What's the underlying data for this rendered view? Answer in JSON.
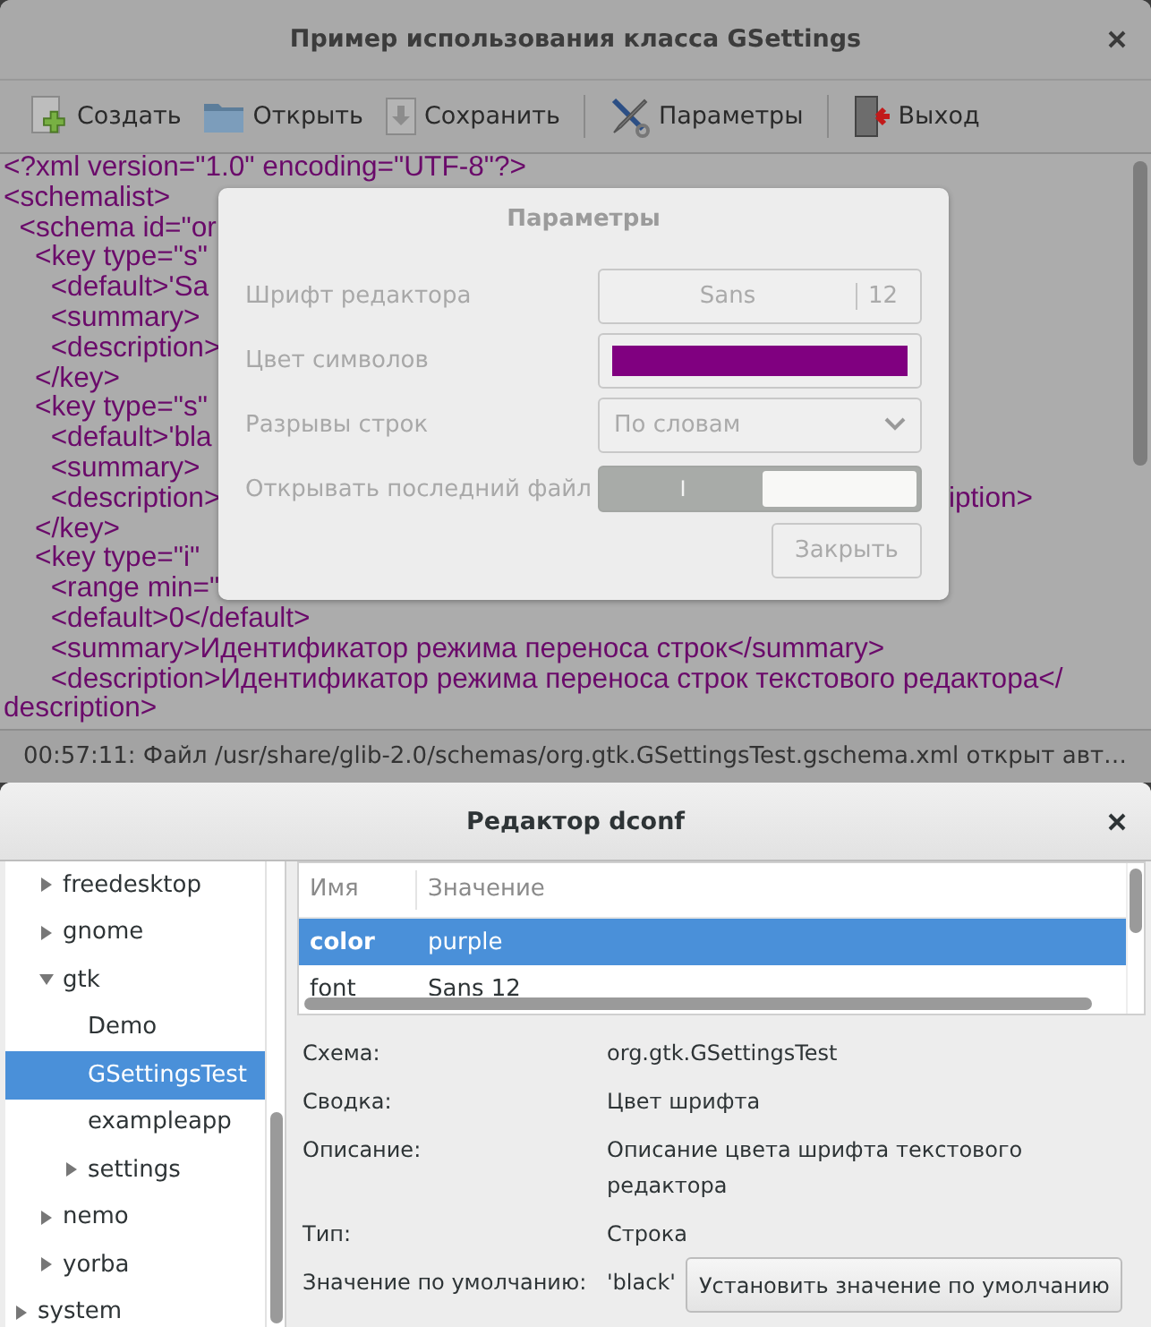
{
  "main_window": {
    "title": "Пример использования класса GSettings",
    "toolbar": [
      [
        {
          "label": "Создать"
        },
        {
          "label": "Открыть"
        },
        {
          "label": "Сохранить"
        }
      ],
      [
        {
          "label": "Параметры"
        }
      ],
      [
        {
          "label": "Выход"
        }
      ]
    ],
    "editor": {
      "lines": [
        {
          "text": "<?xml version=\"1.0\" encoding=\"UTF-8\"?>"
        },
        {
          "text": "<schemalist>"
        },
        {
          "text": "  <schema id=\"or"
        },
        {
          "text": "    <key type=\"s\""
        },
        {
          "text": "      <default>'Sa"
        },
        {
          "text": "      <summary>"
        },
        {
          "text": "      <description>"
        },
        {
          "text": "    </key>"
        },
        {
          "text": "    <key type=\"s\""
        },
        {
          "text": "      <default>'bla"
        },
        {
          "text": "      <summary>"
        },
        {
          "text": "      <description>",
          "right_text": "iption>"
        },
        {
          "text": "    </key>"
        },
        {
          "text": "    <key type=\"i\""
        },
        {
          "text": "      <range min=\""
        },
        {
          "text": "      <default>0</default>"
        },
        {
          "text": "      <summary>Идентификатор режима переноса строк</summary>"
        },
        {
          "text": "      <description>Идентификатор режима переноса строк текстового редактора</"
        },
        {
          "text": "description>"
        }
      ]
    },
    "status_bar": "00:57:11: Файл /usr/share/glib-2.0/schemas/org.gtk.GSettingsTest.gschema.xml открыт авт…"
  },
  "dialog": {
    "title": "Параметры",
    "rows": [
      {
        "kind": "font",
        "label": "Шрифт редактора",
        "font_name": "Sans",
        "font_size": "12"
      },
      {
        "kind": "color",
        "label": "Цвет символов",
        "color": "#800080"
      },
      {
        "kind": "combo",
        "label": "Разрывы строк",
        "value": "По словам"
      },
      {
        "kind": "switch",
        "label": "Открывать последний файл",
        "on": true,
        "switch_text": "I"
      }
    ],
    "close_button": "Закрыть"
  },
  "dconf_window": {
    "title": "Редактор dconf",
    "tree": [
      {
        "children": [
          {
            "label": "freedesktop",
            "expanded": false,
            "selected": false
          },
          {
            "label": "gnome",
            "expanded": false,
            "selected": false
          },
          {
            "label": "gtk",
            "expanded": true,
            "selected": false,
            "children": [
              {
                "label": "Demo",
                "selected": false
              },
              {
                "label": "GSettingsTest",
                "selected": true
              },
              {
                "label": "exampleapp",
                "selected": false
              },
              {
                "label": "settings",
                "expanded": false,
                "selected": false
              }
            ]
          },
          {
            "label": "nemo",
            "expanded": false,
            "selected": false
          },
          {
            "label": "yorba",
            "expanded": false,
            "selected": false
          }
        ]
      },
      {
        "label": "system",
        "expanded": false,
        "selected": false
      }
    ],
    "keys_table": {
      "columns": [
        "Имя",
        "Значение"
      ],
      "rows": [
        {
          "cells": [
            "color",
            "purple"
          ],
          "selected": true
        },
        {
          "cells": [
            "font",
            "Sans 12"
          ],
          "selected": false
        }
      ]
    },
    "details": [
      {
        "label": "Схема:",
        "value": "org.gtk.GSettingsTest"
      },
      {
        "label": "Сводка:",
        "value": "Цвет шрифта"
      },
      {
        "label": "Описание:",
        "value": "Описание цвета шрифта текстового редактора"
      },
      {
        "label": "Тип:",
        "value": "Строка"
      },
      {
        "label": "Значение по умолчанию:",
        "value": "'black'"
      }
    ],
    "default_button": "Установить значение по умолчанию"
  }
}
